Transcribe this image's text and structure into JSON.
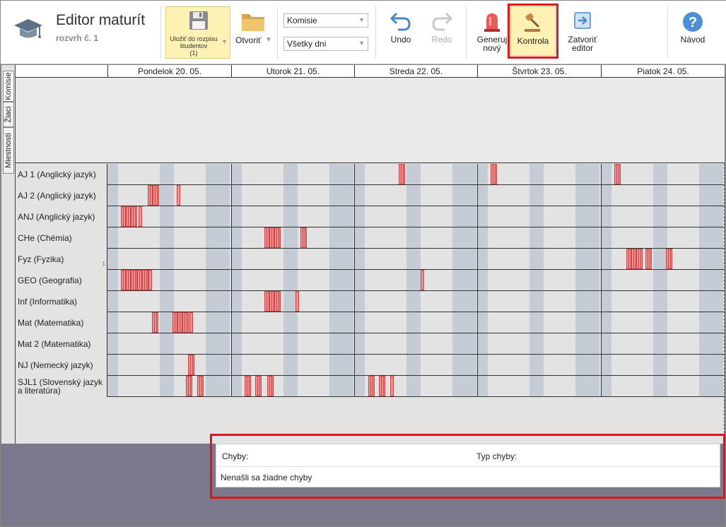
{
  "app": {
    "title": "Editor maturít",
    "subtitle": "rozvrh č. 1"
  },
  "toolbar": {
    "save_label": "Uložiť do rozpisu študentov",
    "save_count": "(1)",
    "open_label": "Otvoriť",
    "select_commission": "Komisie",
    "select_days": "Všetky dni",
    "undo_label": "Undo",
    "redo_label": "Redo",
    "generate_label_1": "Generuj",
    "generate_label_2": "nový",
    "check_label": "Kontrola",
    "close_label_1": "Zatvoriť",
    "close_label_2": "editor",
    "help_label": "Návod"
  },
  "side_tabs": {
    "commissions": "Komisie",
    "students": "Žiaci",
    "rooms": "Miestnosti"
  },
  "days": [
    "Pondelok 20. 05.",
    "Utorok 21. 05.",
    "Streda 22. 05.",
    "Štvrtok 23. 05.",
    "Piatok 24. 05."
  ],
  "rows": [
    {
      "label": "AJ 1 (Anglický jazyk)"
    },
    {
      "label": "AJ 2 (Anglický jazyk)"
    },
    {
      "label": "ANJ (Anglický jazyk)"
    },
    {
      "label": "CHe (Chémia)"
    },
    {
      "label": "Fyz (Fyzika)",
      "count": "1"
    },
    {
      "label": "GEO (Geografia)"
    },
    {
      "label": "Inf (Informatika)"
    },
    {
      "label": "Mat (Matematika)"
    },
    {
      "label": "Mat 2 (Matematika)"
    },
    {
      "label": "NJ (Nemecký jazyk)"
    },
    {
      "label": "SJL1 (Slovenský jazyk a literatúra)"
    }
  ],
  "errors": {
    "col_errors": "Chyby:",
    "col_type": "Typ chyby:",
    "message": "Nenašli sa žiadne chyby"
  },
  "colors": {
    "accent_red": "#e0141e",
    "exam_block": "#ef8f8f",
    "highlight": "#fdf1b3"
  }
}
